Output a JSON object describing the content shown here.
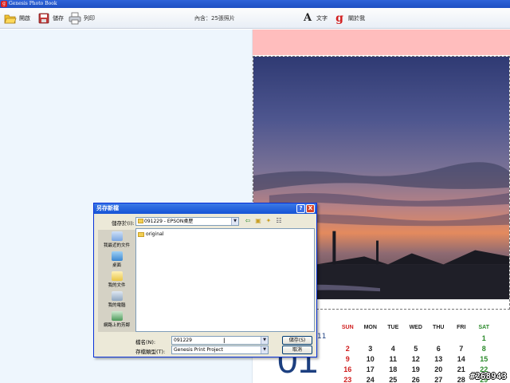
{
  "window": {
    "title": "Genesis Photo Book",
    "app_icon": "g"
  },
  "toolbar": {
    "open_label": "開啟",
    "save_label": "儲存",
    "print_label": "列印",
    "content_info": "內含：25張照片",
    "text_label": "文字",
    "about_label": "關於我",
    "text_icon_glyph": "A",
    "about_icon_glyph": "g"
  },
  "calendar": {
    "month_number": "01",
    "year_fragment": "11",
    "weekdays": [
      "SUN",
      "MON",
      "TUE",
      "WED",
      "THU",
      "FRI",
      "SAT"
    ],
    "weeks": [
      [
        "",
        "",
        "",
        "",
        "",
        "",
        "1"
      ],
      [
        "2",
        "3",
        "4",
        "5",
        "6",
        "7",
        "8"
      ],
      [
        "9",
        "10",
        "11",
        "12",
        "13",
        "14",
        "15"
      ],
      [
        "16",
        "17",
        "18",
        "19",
        "20",
        "21",
        "22"
      ],
      [
        "23",
        "24",
        "25",
        "26",
        "27",
        "28",
        "29"
      ]
    ]
  },
  "watermark": "#268943",
  "dialog": {
    "title": "另存新檔",
    "help_glyph": "?",
    "close_glyph": "X",
    "lookin_label": "儲存於(I):",
    "lookin_value": "091229 - EPSON桌歷",
    "places": [
      "我最近的文件",
      "桌面",
      "我的文件",
      "我的電腦",
      "網路上的芳鄰"
    ],
    "files": [
      "original"
    ],
    "filename_label": "檔名(N):",
    "filename_value": "091229",
    "filetype_label": "存檔類型(T):",
    "filetype_value": "Genesis Print Project",
    "save_button": "儲存(S)",
    "cancel_button": "取消"
  },
  "colors": {
    "accent_pink": "#ffbdbd",
    "left_panel": "#eef6fd",
    "calendar_blue": "#1c3f80",
    "sunday_red": "#d01c1c",
    "saturday_green": "#2b8a2b"
  }
}
